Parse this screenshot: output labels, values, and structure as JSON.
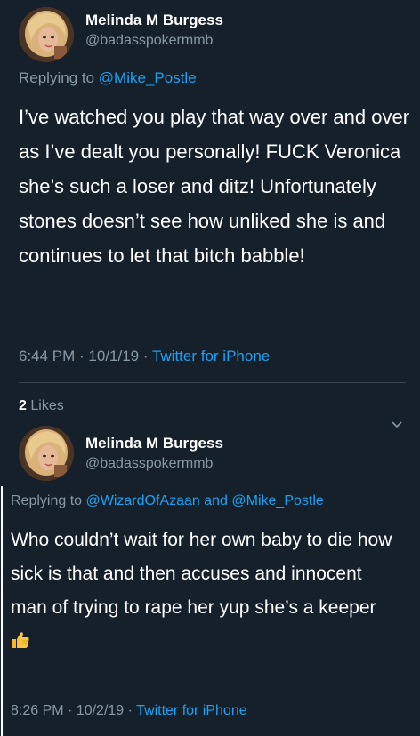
{
  "tweet1": {
    "display_name": "Melinda M Burgess",
    "handle": "@badasspokermmb",
    "reply_prefix": "Replying to",
    "reply_to": "@Mike_Postle",
    "text": "I’ve watched you play that way over and over as I’ve dealt you personally! FUCK Veronica she’s such a loser and ditz! Unfortunately stones doesn’t see how unliked she is and continues to let that bitch babble!",
    "timestamp": "6:44 PM · 10/1/19 ·",
    "source": "Twitter for iPhone",
    "likes_count": "2",
    "likes_label": "Likes"
  },
  "tweet2": {
    "display_name": "Melinda M Burgess",
    "handle": "@badasspokermmb",
    "reply_prefix": "Replying to",
    "reply_to_1": "@WizardOfAzaan",
    "reply_and": "and",
    "reply_to_2": "@Mike_Postle",
    "text": "Who couldn’t wait for her own baby to die how sick is that and then accuses and innocent man of trying to rape her yup she’s a keeper",
    "emoji": "thumbs-up-icon",
    "timestamp": "8:26 PM · 10/2/19 ·",
    "source": "Twitter for iPhone"
  },
  "colors": {
    "background": "#15202b",
    "text": "#ffffff",
    "secondary": "#8899a6",
    "link": "#1da1f2",
    "divider": "#38444d"
  }
}
